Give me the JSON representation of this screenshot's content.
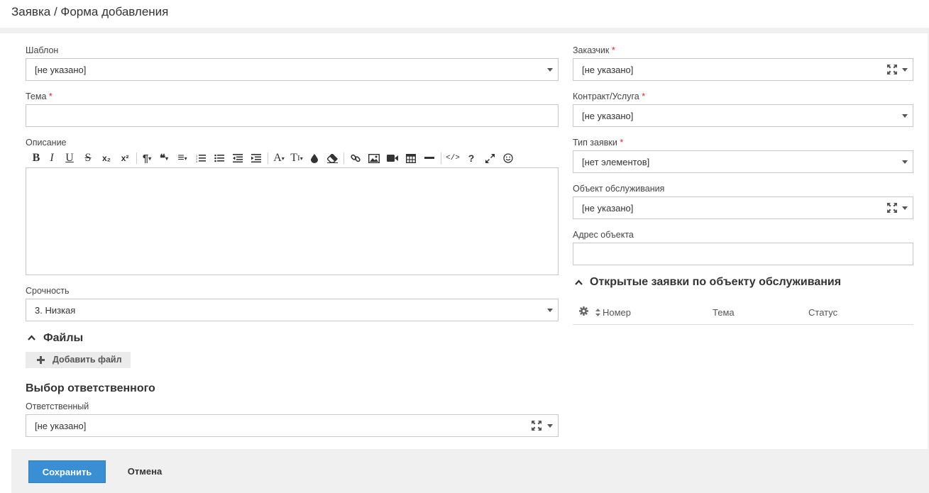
{
  "page": {
    "title": "Заявка / Форма добавления"
  },
  "left": {
    "template": {
      "label": "Шаблон",
      "value": "[не указано]"
    },
    "subject": {
      "label": "Тема",
      "required_mark": "*",
      "value": ""
    },
    "description": {
      "label": "Описание",
      "value": ""
    },
    "urgency": {
      "label": "Срочность",
      "value": "3. Низкая"
    },
    "files": {
      "title": "Файлы",
      "add_label": "Добавить файл"
    },
    "responsible_section": {
      "title": "Выбор ответственного"
    },
    "responsible": {
      "label": "Ответственный",
      "value": "[не указано]"
    }
  },
  "editor_toolbar": {
    "bold": "B",
    "italic": "I",
    "underline": "U",
    "strike": "S",
    "subscript": "x₂",
    "superscript": "x²",
    "paragraph": "¶",
    "quote": "❝",
    "align": "≡",
    "font_size": "A",
    "text_style": "T",
    "help": "?",
    "code": "</>"
  },
  "right": {
    "customer": {
      "label": "Заказчик",
      "required_mark": "*",
      "value": "[не указано]"
    },
    "contract": {
      "label": "Контракт/Услуга",
      "required_mark": "*",
      "value": "[не указано]"
    },
    "request_type": {
      "label": "Тип заявки",
      "required_mark": "*",
      "value": "[нет элементов]"
    },
    "service_object": {
      "label": "Объект обслуживания",
      "value": "[не указано]"
    },
    "object_address": {
      "label": "Адрес объекта",
      "value": ""
    },
    "open_requests": {
      "title": "Открытые заявки по объекту обслуживания",
      "columns": [
        "Номер",
        "Тема",
        "Статус"
      ]
    }
  },
  "footer": {
    "save_label": "Сохранить",
    "cancel_label": "Отмена"
  },
  "colors": {
    "accent": "#3a8fd4",
    "required": "#d9232d",
    "footer_bg": "#f0f0f0"
  }
}
